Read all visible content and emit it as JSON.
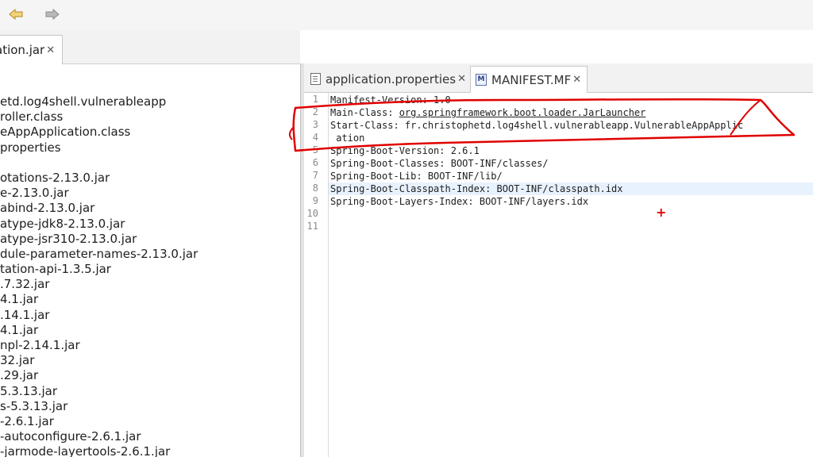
{
  "toolbar": {
    "back_icon": "back-arrow-icon",
    "forward_icon": "forward-arrow-icon"
  },
  "left_pane": {
    "tab_label": "ation.jar",
    "tab_close": "✕",
    "tree_items": [
      "etd.log4shell.vulnerableapp",
      "roller.class",
      "eAppApplication.class",
      "properties",
      "",
      "otations-2.13.0.jar",
      "e-2.13.0.jar",
      "abind-2.13.0.jar",
      "atype-jdk8-2.13.0.jar",
      "atype-jsr310-2.13.0.jar",
      "dule-parameter-names-2.13.0.jar",
      "tation-api-1.3.5.jar",
      ".7.32.jar",
      "4.1.jar",
      ".14.1.jar",
      "4.1.jar",
      "npl-2.14.1.jar",
      "32.jar",
      ".29.jar",
      "5.3.13.jar",
      "s-5.3.13.jar",
      "-2.6.1.jar",
      "-autoconfigure-2.6.1.jar",
      "-jarmode-layertools-2.6.1.jar"
    ]
  },
  "editor": {
    "tabs": [
      {
        "label": "application.properties",
        "close": "✕",
        "icon": "properties-file-icon"
      },
      {
        "label": "MANIFEST.MF",
        "close": "✕",
        "icon": "manifest-file-icon",
        "icon_glyph": "M"
      }
    ],
    "line_numbers": [
      "1",
      "2",
      "3",
      "4",
      "5",
      "6",
      "7",
      "8",
      "9",
      "10",
      "11"
    ],
    "lines": [
      {
        "text": "Manifest-Version: 1.0"
      },
      {
        "prefix": "Main-Class: ",
        "link": "org.springframework.boot.loader.JarLauncher"
      },
      {
        "text": "Start-Class: fr.christophetd.log4shell.vulnerableapp.VulnerableAppApplic"
      },
      {
        "text": " ation"
      },
      {
        "text": "Spring-Boot-Version: 2.6.1"
      },
      {
        "text": "Spring-Boot-Classes: BOOT-INF/classes/"
      },
      {
        "text": "Spring-Boot-Lib: BOOT-INF/lib/"
      },
      {
        "text": "Spring-Boot-Classpath-Index: BOOT-INF/classpath.idx"
      },
      {
        "text": "Spring-Boot-Layers-Index: BOOT-INF/layers.idx"
      },
      {
        "text": ""
      },
      {
        "text": ""
      }
    ],
    "current_line": 8
  },
  "annotation": {
    "color": "#e00000",
    "cursor_glyph": "+"
  }
}
